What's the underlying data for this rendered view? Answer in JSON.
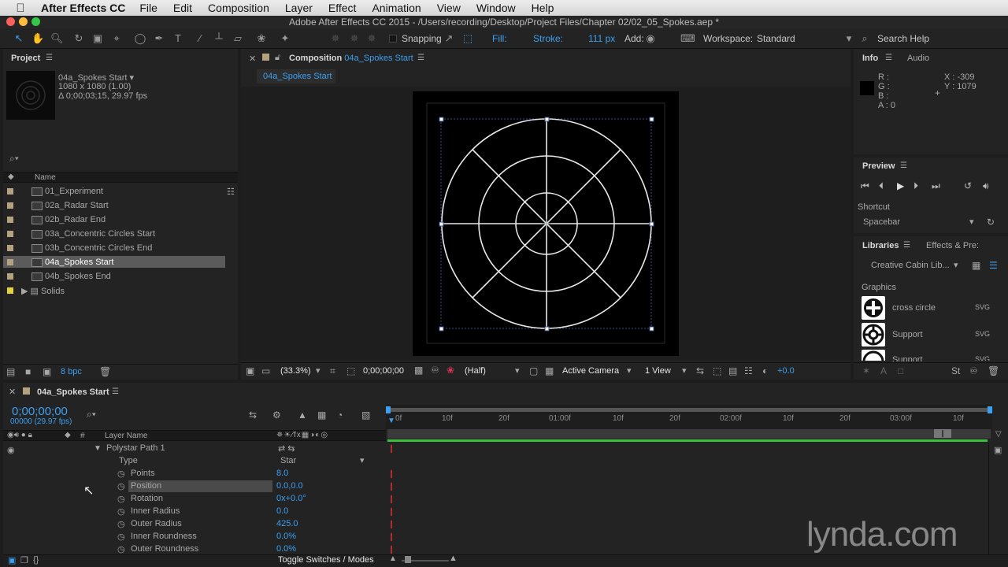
{
  "menubar": {
    "app": "After Effects CC",
    "items": [
      "File",
      "Edit",
      "Composition",
      "Layer",
      "Effect",
      "Animation",
      "View",
      "Window",
      "Help"
    ]
  },
  "window": {
    "title": "Adobe After Effects CC 2015 - /Users/recording/Desktop/Project Files/Chapter 02/02_05_Spokes.aep *"
  },
  "toolbar": {
    "snapping": "Snapping",
    "fill_label": "Fill:",
    "stroke_label": "Stroke:",
    "stroke_width": "111 px",
    "add_label": "Add:",
    "workspace_label": "Workspace:",
    "workspace_value": "Standard",
    "search_placeholder": "Search Help"
  },
  "project": {
    "title": "Project",
    "comp_name": "04a_Spokes Start ▾",
    "comp_size": "1080 x 1080 (1.00)",
    "comp_duration": "Δ 0;00;03;15, 29.97 fps",
    "column_name": "Name",
    "items": [
      {
        "label": "01_Experiment"
      },
      {
        "label": "02a_Radar Start"
      },
      {
        "label": "02b_Radar End"
      },
      {
        "label": "03a_Concentric Circles Start"
      },
      {
        "label": "03b_Concentric Circles End"
      },
      {
        "label": "04a_Spokes Start"
      },
      {
        "label": "04b_Spokes End"
      },
      {
        "label": "Solids"
      }
    ],
    "bpc": "8 bpc"
  },
  "composition": {
    "panel_label": "Composition",
    "comp_tab": "04a_Spokes Start",
    "flow_tab": "04a_Spokes Start",
    "zoom": "(33.3%)",
    "timecode": "0;00;00;00",
    "resolution": "(Half)",
    "camera": "Active Camera",
    "views": "1 View",
    "exposure": "+0.0"
  },
  "info": {
    "tab_info": "Info",
    "tab_audio": "Audio",
    "r": "R :",
    "g": "G :",
    "b": "B :",
    "a": "A : 0",
    "x": "X : -309",
    "y": "Y : 1079"
  },
  "preview": {
    "title": "Preview",
    "shortcut_label": "Shortcut",
    "shortcut_value": "Spacebar"
  },
  "libraries": {
    "tab_libraries": "Libraries",
    "tab_effects": "Effects & Pre:",
    "library_name": "Creative Cabin Lib...",
    "section": "Graphics",
    "items": [
      {
        "name": "cross circle",
        "type": "SVG"
      },
      {
        "name": "Support",
        "type": "SVG"
      },
      {
        "name": "Support",
        "type": "SVG"
      }
    ]
  },
  "timeline": {
    "tab": "04a_Spokes Start",
    "timecode": "0;00;00;00",
    "fps": "00000 (29.97 fps)",
    "col_layer_name": "Layer Name",
    "col_hash": "#",
    "ticks": [
      "0f",
      "10f",
      "20f",
      "01:00f",
      "10f",
      "20f",
      "02:00f",
      "10f",
      "20f",
      "03:00f",
      "10f"
    ],
    "group": "Polystar Path 1",
    "properties": [
      {
        "name": "Type",
        "value": "Star"
      },
      {
        "name": "Points",
        "value": "8.0"
      },
      {
        "name": "Position",
        "value": "0.0,0.0"
      },
      {
        "name": "Rotation",
        "value": "0x+0.0°"
      },
      {
        "name": "Inner Radius",
        "value": "0.0"
      },
      {
        "name": "Outer Radius",
        "value": "425.0"
      },
      {
        "name": "Inner Roundness",
        "value": "0.0%"
      },
      {
        "name": "Outer Roundness",
        "value": "0.0%"
      }
    ],
    "toggle": "Toggle Switches / Modes"
  },
  "watermark": "lynda.com",
  "colors": {
    "accent": "#3c9ff0",
    "panel": "#232323",
    "keyframe": "#b52a2a",
    "work_area": "#3fbf3f"
  }
}
